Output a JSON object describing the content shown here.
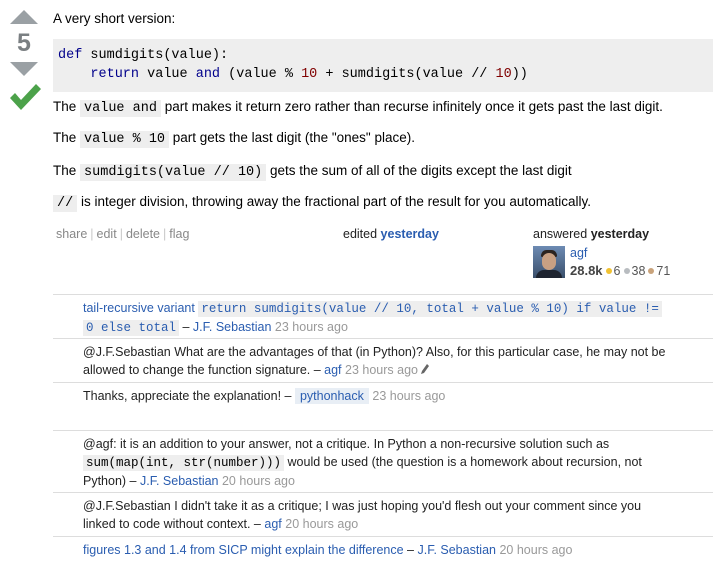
{
  "vote": {
    "count": "5"
  },
  "answer": {
    "intro": "A very short version:",
    "code_line1": {
      "kw": "def",
      "rest": " sumdigits(value):"
    },
    "code_line2": {
      "indent": "    ",
      "kw1": "return",
      "a": " value ",
      "kw2": "and",
      "b": " (value % ",
      "n1": "10",
      "c": " + sumdigits(value // ",
      "n2": "10",
      "d": "))"
    },
    "p1": {
      "pre": "The ",
      "code": "value and",
      "post": " part makes it return zero rather than recurse infinitely once it gets past the last digit."
    },
    "p2": {
      "pre": "The ",
      "code": "value % 10",
      "post": " part gets the last digit (the \"ones\" place)."
    },
    "p3": {
      "pre": "The ",
      "code": "sumdigits(value // 10)",
      "post": " gets the sum of all of the digits except the last digit"
    },
    "p4": {
      "code": "//",
      "post": " is integer division, throwing away the fractional part of the result for you automatically."
    }
  },
  "menu": {
    "share": "share",
    "edit": "edit",
    "delete": "delete",
    "flag": "flag"
  },
  "edited": {
    "label": "edited",
    "when": "yesterday"
  },
  "answered": {
    "label": "answered",
    "when": "yesterday"
  },
  "user": {
    "name": "agf",
    "rep": "28.8k",
    "gold": "6",
    "silver": "38",
    "bronze": "71"
  },
  "colors": {
    "gold": "#f1c232",
    "silver": "#b8bcc0",
    "bronze": "#c9a37b",
    "link": "#2a5db0"
  },
  "comments": [
    {
      "link_text": "tail-recursive variant",
      "code_a": "return sumdigits(value // 10, total + value % 10) if value !=",
      "code_b": "0 else total",
      "dash": " – ",
      "user": "J.F. Sebastian",
      "time": "23 hours ago"
    },
    {
      "text1": "@J.F.Sebastian What are the advantages of that (in Python)? Also, for this particular case, he may not be",
      "text2": "allowed to change the function signature. – ",
      "user": "agf",
      "time": "23 hours ago"
    },
    {
      "text": "Thanks, appreciate the explanation! – ",
      "user": "pythonhack",
      "time": "23 hours ago"
    },
    {
      "text1": "@agf: it is an addition to your answer, not a critique. In Python a non-recursive solution such as",
      "code": "sum(map(int, str(number)))",
      "text2": " would be used (the question is a homework about recursion, not",
      "text3": "Python) – ",
      "user": "J.F. Sebastian",
      "time": "20 hours ago"
    },
    {
      "text1": "@J.F.Sebastian I didn't take it as a critique; I was just hoping you'd flesh out your comment since you",
      "text2": "linked to code without context. – ",
      "user": "agf",
      "time": "20 hours ago"
    },
    {
      "link_text": "figures 1.3 and 1.4 from SICP might explain the difference",
      "dash": " – ",
      "user": "J.F. Sebastian",
      "time": "20 hours ago"
    }
  ]
}
